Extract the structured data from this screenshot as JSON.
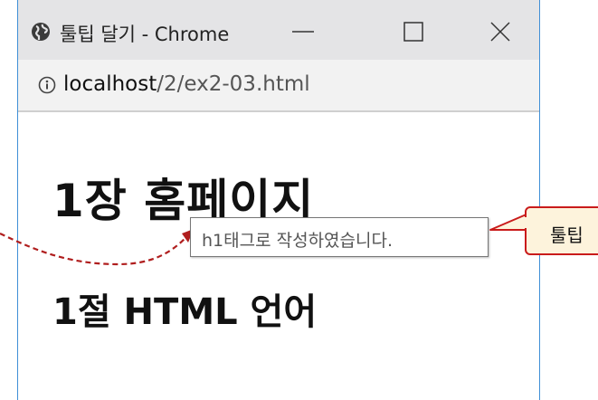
{
  "window": {
    "title": "툴팁 달기 - Chrome",
    "favicon_icon": "globe-icon",
    "minimize_icon": "minimize-icon",
    "maximize_icon": "maximize-icon",
    "close_icon": "close-icon"
  },
  "address_bar": {
    "info_icon": "info-icon",
    "host": "localhost",
    "path": "/2/ex2-03.html"
  },
  "content": {
    "h1": "1장 홈페이지",
    "h2": "1절 HTML 언어"
  },
  "tooltip": {
    "text": "h1태그로 작성하였습니다."
  },
  "annotation": {
    "label": "툴팁",
    "border_color": "#c91b1b",
    "background_color": "#fdf3dc",
    "arrow_color": "#c91b1b"
  }
}
